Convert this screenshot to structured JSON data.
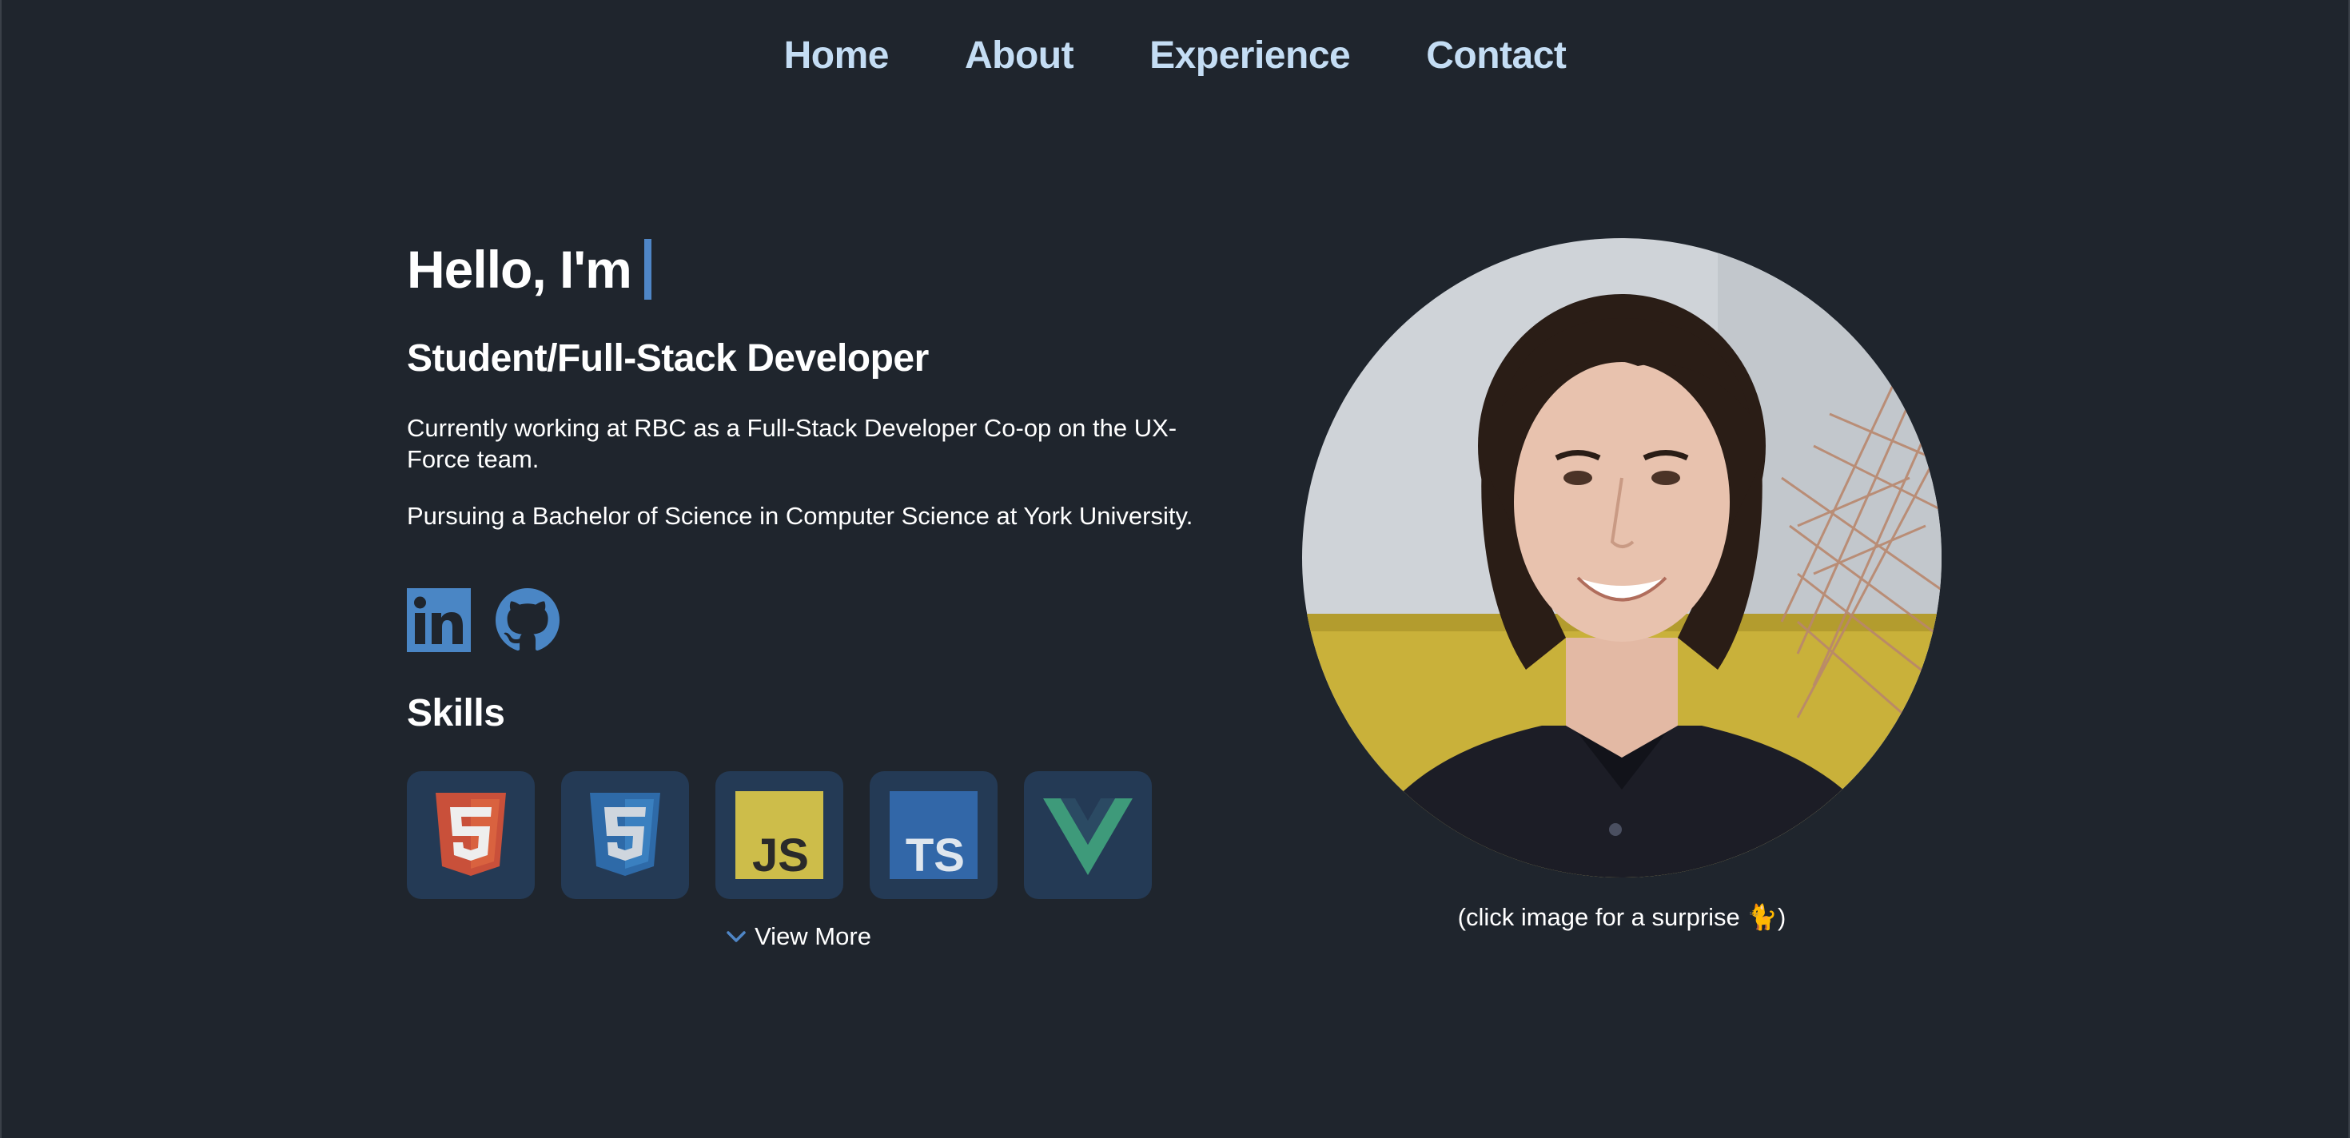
{
  "nav": {
    "items": [
      {
        "label": "Home"
      },
      {
        "label": "About"
      },
      {
        "label": "Experience"
      },
      {
        "label": "Contact"
      }
    ]
  },
  "hero": {
    "greeting": "Hello, I'm",
    "role": "Student/Full-Stack Developer",
    "paragraphs": [
      "Currently working at RBC as a Full-Stack Developer Co-op on the UX-Force team.",
      "Pursuing a Bachelor of Science in Computer Science at York University."
    ]
  },
  "socials": [
    {
      "icon": "linkedin-icon"
    },
    {
      "icon": "github-icon"
    }
  ],
  "skills": {
    "title": "Skills",
    "items": [
      {
        "icon": "html5-icon"
      },
      {
        "icon": "css3-icon"
      },
      {
        "icon": "javascript-icon",
        "text": "JS"
      },
      {
        "icon": "typescript-icon",
        "text": "TS"
      },
      {
        "icon": "vue-icon"
      }
    ],
    "view_more_label": "View More"
  },
  "portrait": {
    "caption": "(click image for a surprise 🐈)"
  },
  "colors": {
    "background": "#1f252d",
    "nav_link": "#c4ddf4",
    "accent": "#4f86c6",
    "skill_tile": "#243a55"
  }
}
